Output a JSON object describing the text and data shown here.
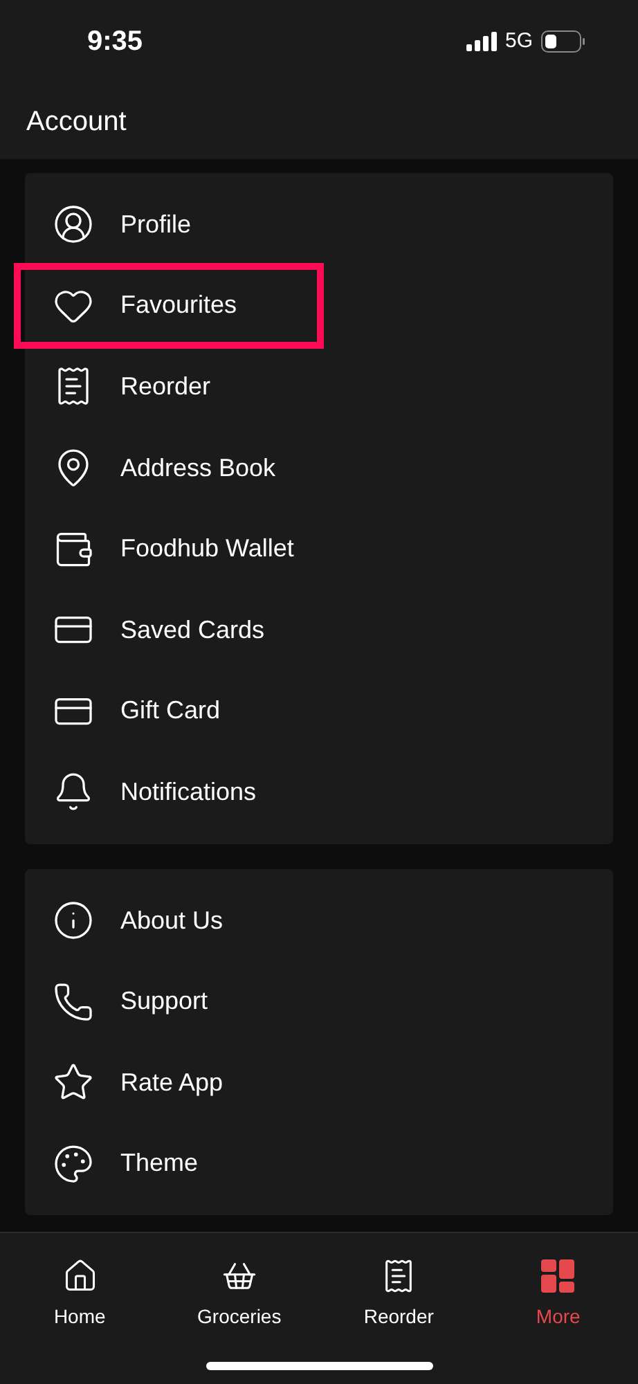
{
  "status_bar": {
    "time": "9:35",
    "network": "5G"
  },
  "header": {
    "title": "Account"
  },
  "sections": [
    {
      "items": [
        {
          "label": "Profile",
          "highlighted": false
        },
        {
          "label": "Favourites",
          "highlighted": true
        },
        {
          "label": "Reorder",
          "highlighted": false
        },
        {
          "label": "Address Book",
          "highlighted": false
        },
        {
          "label": "Foodhub Wallet",
          "highlighted": false
        },
        {
          "label": "Saved Cards",
          "highlighted": false
        },
        {
          "label": "Gift Card",
          "highlighted": false
        },
        {
          "label": "Notifications",
          "highlighted": false
        }
      ]
    },
    {
      "items": [
        {
          "label": "About Us",
          "highlighted": false
        },
        {
          "label": "Support",
          "highlighted": false
        },
        {
          "label": "Rate App",
          "highlighted": false
        },
        {
          "label": "Theme",
          "highlighted": false
        }
      ]
    }
  ],
  "tab_bar": [
    {
      "label": "Home",
      "selected": false
    },
    {
      "label": "Groceries",
      "selected": false
    },
    {
      "label": "Reorder",
      "selected": false
    },
    {
      "label": "More",
      "selected": true
    }
  ]
}
